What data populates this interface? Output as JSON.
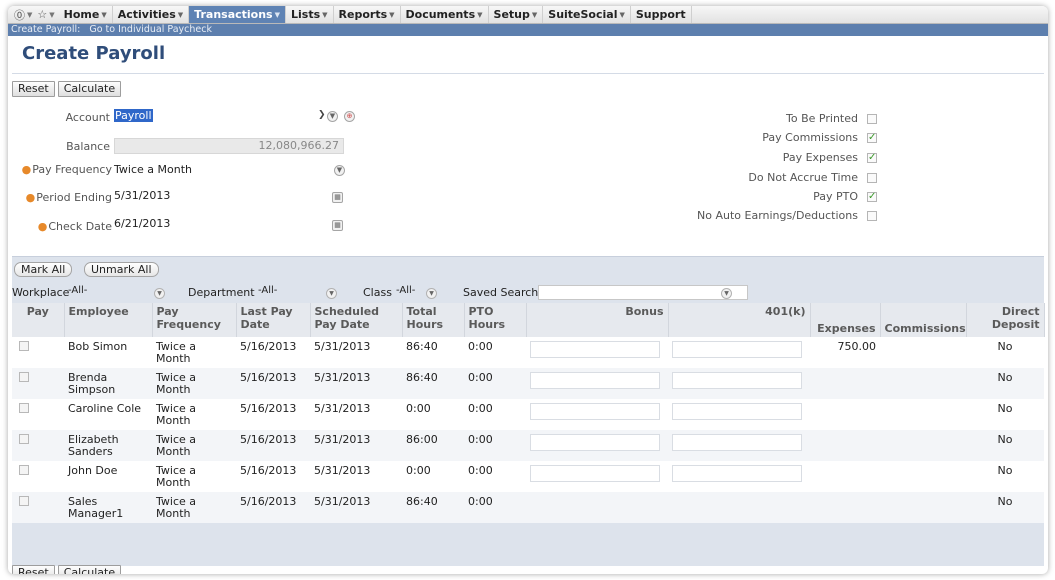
{
  "nav": {
    "items": [
      {
        "label": "Home",
        "active": false
      },
      {
        "label": "Activities",
        "active": false
      },
      {
        "label": "Transactions",
        "active": true
      },
      {
        "label": "Lists",
        "active": false
      },
      {
        "label": "Reports",
        "active": false
      },
      {
        "label": "Documents",
        "active": false
      },
      {
        "label": "Setup",
        "active": false
      },
      {
        "label": "SuiteSocial",
        "active": false
      },
      {
        "label": "Support",
        "active": false
      }
    ]
  },
  "subnav": {
    "current": "Create Payroll:",
    "link": "Go to Individual Paycheck"
  },
  "page": {
    "title": "Create Payroll"
  },
  "buttons": {
    "reset": "Reset",
    "calculate": "Calculate",
    "mark_all": "Mark All",
    "unmark_all": "Unmark All"
  },
  "form": {
    "account_label": "Account",
    "account_value": "Payroll",
    "balance_label": "Balance",
    "balance_value": "12,080,966.27",
    "pay_frequency_label": "Pay Frequency",
    "pay_frequency_value": "Twice a Month",
    "period_ending_label": "Period Ending",
    "period_ending_value": "5/31/2013",
    "check_date_label": "Check Date",
    "check_date_value": "6/21/2013"
  },
  "options": [
    {
      "label": "To Be Printed",
      "checked": false
    },
    {
      "label": "Pay Commissions",
      "checked": true
    },
    {
      "label": "Pay Expenses",
      "checked": true
    },
    {
      "label": "Do Not Accrue Time",
      "checked": false
    },
    {
      "label": "Pay PTO",
      "checked": true
    },
    {
      "label": "No Auto Earnings/Deductions",
      "checked": false
    }
  ],
  "filters": {
    "workplace_label": "Workplace",
    "workplace_value": "-All-",
    "department_label": "Department",
    "department_value": "-All-",
    "class_label": "Class",
    "class_value": "-All-",
    "saved_search_label": "Saved Search"
  },
  "table": {
    "headers": [
      "Pay",
      "Employee",
      "Pay Frequency",
      "Last Pay Date",
      "Scheduled Pay Date",
      "Total Hours",
      "PTO Hours",
      "Bonus",
      "401(k)",
      "Expenses",
      "Commissions",
      "Direct Deposit"
    ],
    "rows": [
      {
        "employee": "Bob Simon",
        "frequency": "Twice a Month",
        "last_pay": "5/16/2013",
        "scheduled": "5/31/2013",
        "total_hours": "86:40",
        "pto_hours": "0:00",
        "expenses": "750.00",
        "direct_deposit": "No"
      },
      {
        "employee": "Brenda Simpson",
        "frequency": "Twice a Month",
        "last_pay": "5/16/2013",
        "scheduled": "5/31/2013",
        "total_hours": "86:40",
        "pto_hours": "0:00",
        "expenses": "",
        "direct_deposit": "No"
      },
      {
        "employee": "Caroline Cole",
        "frequency": "Twice a Month",
        "last_pay": "5/16/2013",
        "scheduled": "5/31/2013",
        "total_hours": "0:00",
        "pto_hours": "0:00",
        "expenses": "",
        "direct_deposit": "No"
      },
      {
        "employee": "Elizabeth Sanders",
        "frequency": "Twice a Month",
        "last_pay": "5/16/2013",
        "scheduled": "5/31/2013",
        "total_hours": "86:00",
        "pto_hours": "0:00",
        "expenses": "",
        "direct_deposit": "No"
      },
      {
        "employee": "John Doe",
        "frequency": "Twice a Month",
        "last_pay": "5/16/2013",
        "scheduled": "5/31/2013",
        "total_hours": "0:00",
        "pto_hours": "0:00",
        "expenses": "",
        "direct_deposit": "No"
      },
      {
        "employee": "Sales Manager1",
        "frequency": "Twice a Month",
        "last_pay": "5/16/2013",
        "scheduled": "5/31/2013",
        "total_hours": "86:40",
        "pto_hours": "0:00",
        "expenses": "",
        "direct_deposit": "No"
      }
    ]
  },
  "colors": {
    "nav_active": "#5f83b4",
    "subnav": "#5d7fae",
    "title": "#2f4d7a",
    "required": "#e7892a",
    "check": "#3c9a2b"
  }
}
